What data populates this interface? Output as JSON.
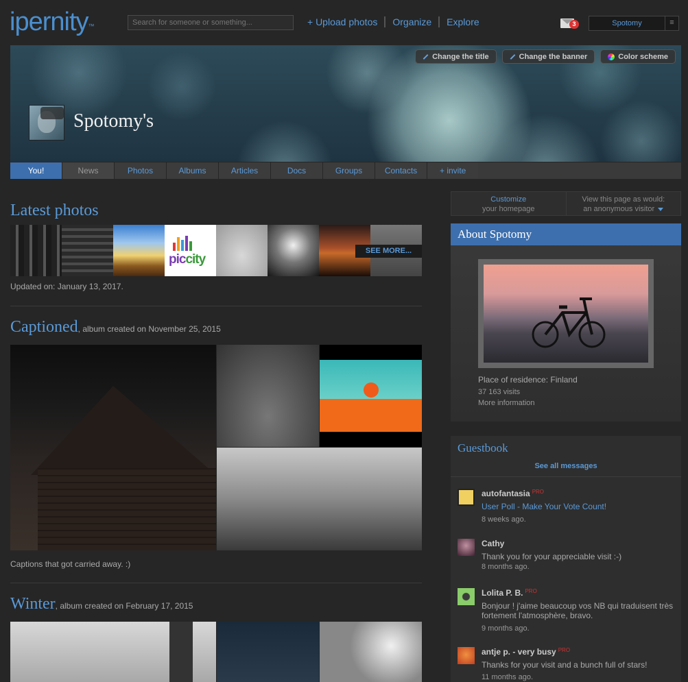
{
  "header": {
    "logo": "ipernity",
    "logo_tm": "™",
    "search_placeholder": "Search for someone or something...",
    "nav": [
      "+ Upload photos",
      "Organize",
      "Explore"
    ],
    "mail_count": "3",
    "username": "Spotomy",
    "menu_icon": "≡"
  },
  "banner": {
    "title": "Spotomy's",
    "buttons": [
      "Change the title",
      "Change the banner",
      "Color scheme"
    ]
  },
  "tabs": [
    "You!",
    "News",
    "Photos",
    "Albums",
    "Articles",
    "Docs",
    "Groups",
    "Contacts",
    "+ invite"
  ],
  "latest": {
    "title": "Latest photos",
    "see_more": "SEE MORE...",
    "updated": "Updated on: January 13, 2017.",
    "logo_text_a": "pic",
    "logo_text_b": "city"
  },
  "captioned": {
    "title": "Captioned",
    "subtitle": ", album created on November 25, 2015",
    "caption": "Captions that got carried away. :)"
  },
  "winter": {
    "title": "Winter",
    "subtitle": ", album created on February 17, 2015"
  },
  "customize": {
    "left_line1": "Customize",
    "left_line2": "your homepage",
    "right_line1": "View this page as would:",
    "right_line2": "an anonymous visitor"
  },
  "about": {
    "title": "About Spotomy",
    "residence": "Place of residence: Finland",
    "visits": "37 163 visits",
    "more": "More information"
  },
  "guestbook": {
    "title": "Guestbook",
    "see_all": "See all messages",
    "messages": [
      {
        "author": "autofantasia",
        "pro": "PRO",
        "text": "User Poll - Make Your Vote Count!",
        "when": "8 weeks ago."
      },
      {
        "author": "Cathy",
        "pro": "",
        "text": "Thank you for your appreciable visit :-)",
        "when": "8 months ago."
      },
      {
        "author": "Lolita P. B.",
        "pro": "PRO",
        "text": "Bonjour ! j'aime beaucoup vos NB qui traduisent très fortement l'atmosphère, bravo.",
        "when": "9 months ago."
      },
      {
        "author": "antje p. - very busy",
        "pro": "PRO",
        "text": "Thanks for your visit and a bunch full of stars!",
        "when": "11 months ago."
      }
    ]
  },
  "colors": {
    "accent": "#5a9ad8",
    "active_tab": "#3d6fae",
    "bg": "#262626"
  }
}
